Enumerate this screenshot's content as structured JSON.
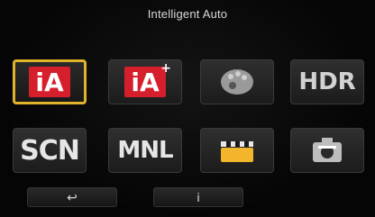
{
  "header": {
    "title": "Intelligent Auto"
  },
  "modes": [
    {
      "id": "ia",
      "label": "iA",
      "icon": "ia-icon",
      "selected": true
    },
    {
      "id": "ia-plus",
      "label": "iA",
      "icon": "ia-plus-icon",
      "selected": false
    },
    {
      "id": "creative",
      "label": "",
      "icon": "palette-icon",
      "selected": false
    },
    {
      "id": "hdr",
      "label": "HDR",
      "icon": "hdr-icon",
      "selected": false
    },
    {
      "id": "scn",
      "label": "SCN",
      "icon": "scn-icon",
      "selected": false
    },
    {
      "id": "manual",
      "label": "MNL",
      "icon": "manual-icon",
      "selected": false
    },
    {
      "id": "movie",
      "label": "",
      "icon": "clapper-icon",
      "selected": false
    },
    {
      "id": "custom",
      "label": "",
      "icon": "camera-custom-icon",
      "selected": false
    }
  ],
  "footer": {
    "back_label": "",
    "info_label": ""
  },
  "colors": {
    "selected_border": "#e0b32b",
    "ia_red": "#d61f2c",
    "clapper_yellow": "#f3b52b"
  }
}
